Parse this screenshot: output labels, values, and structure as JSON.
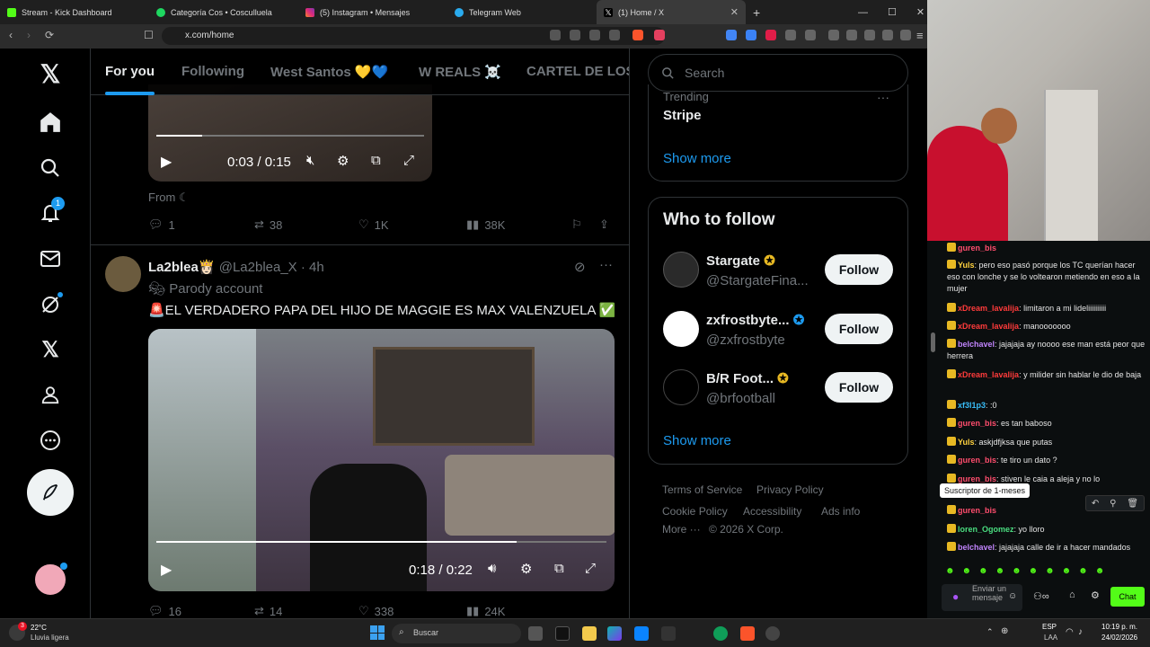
{
  "browser": {
    "tabs": [
      {
        "label": "Stream - Kick Dashboard",
        "color": "#53fc18",
        "active": false
      },
      {
        "label": "Categoría Cos • Cosculluela",
        "color": "#1ed760",
        "active": false
      },
      {
        "label": "(5) Instagram • Mensajes",
        "color": "#e1306c",
        "active": false
      },
      {
        "label": "Telegram Web",
        "color": "#2aabee",
        "active": false
      },
      {
        "label": "(1) Home / X",
        "color": "#ffffff",
        "active": true
      }
    ],
    "new_tab": "+",
    "url": "x.com/home"
  },
  "x_nav": {
    "notification_count": "1"
  },
  "feed": {
    "tabs": [
      "For you",
      "Following",
      "West Santos 💛💙",
      "W REALS ☠️",
      "CARTEL DE LOS"
    ],
    "post1": {
      "video_time": "0:03 / 0:15",
      "from_label": "From",
      "replies": "1",
      "reposts": "38",
      "likes": "1K",
      "views": "38K"
    },
    "post2": {
      "name": "La2blea👸🏻",
      "handle": "@La2blea_X",
      "time": "· 4h",
      "parody": "Parody account",
      "text": "🚨EL VERDADERO PAPA DEL HIJO DE MAGGIE ES MAX VALENZUELA ✅",
      "video_time": "0:18 / 0:22",
      "replies": "16",
      "reposts": "14",
      "likes": "338",
      "views": "24K"
    }
  },
  "right": {
    "search_placeholder": "Search",
    "trending_label": "Trending",
    "trending_topic": "Stripe",
    "show_more": "Show more",
    "who_to_follow": "Who to follow",
    "follow_label": "Follow",
    "accounts": [
      {
        "name": "Stargate",
        "handle": "@StargateFina..."
      },
      {
        "name": "zxfrostbyte...",
        "handle": "@zxfrostbyte"
      },
      {
        "name": "B/R Foot...",
        "handle": "@brfootball"
      }
    ],
    "footer": [
      "Terms of Service",
      "Privacy Policy",
      "Cookie Policy",
      "Accessibility",
      "Ads info",
      "More ···",
      "© 2026 X Corp."
    ]
  },
  "chat": {
    "messages": [
      {
        "user": "guren_bis",
        "color": "#ff4d6d",
        "text": ""
      },
      {
        "user": "Yuls",
        "color": "#ffd23f",
        "text": "pero eso pasó porque los TC querían hacer eso con lonche y se lo voltearon metiendo en eso a la mujer"
      },
      {
        "user": "xDream_lavalija",
        "color": "#ff3b3b",
        "text": "limitaron a mi lideliiiiiiiiii"
      },
      {
        "user": "xDream_lavalija",
        "color": "#ff3b3b",
        "text": "manooooooo"
      },
      {
        "user": "belchavel",
        "color": "#c084fc",
        "text": "jajajaja ay noooo ese man está peor que herrera"
      },
      {
        "user": "xDream_lavalija",
        "color": "#ff3b3b",
        "text": "y milider sin hablar le dio de baja"
      },
      {
        "user": "xf3l1p3",
        "color": "#38bdf8",
        "text": ":0"
      },
      {
        "user": "guren_bis",
        "color": "#ff4d6d",
        "text": "es tan baboso"
      },
      {
        "user": "Yuls",
        "color": "#ffd23f",
        "text": "askjdfjksa que putas"
      },
      {
        "user": "guren_bis",
        "color": "#ff4d6d",
        "text": "te tiro un dato ?"
      },
      {
        "user": "guren_bis",
        "color": "#ff4d6d",
        "text": "stiven le caia a aleja y no lo"
      },
      {
        "user": "guren_bis",
        "color": "#ff4d6d",
        "text": ""
      },
      {
        "user": "loren_Ogomez",
        "color": "#4ade80",
        "text": "yo lloro"
      },
      {
        "user": "belchavel",
        "color": "#c084fc",
        "text": "jajajaja calle de ir a hacer mandados"
      }
    ],
    "tooltip": "Suscriptor de 1-meses",
    "input_placeholder": "Enviar un mensaje",
    "send_label": "Chat"
  },
  "taskbar": {
    "weather_temp": "22°C",
    "weather_desc": "Lluvia ligera",
    "search_placeholder": "Buscar",
    "lang": "ESP",
    "lang_sub": "LAA",
    "time": "10:19 p. m.",
    "date": "24/02/2026",
    "badge_count": "3"
  }
}
